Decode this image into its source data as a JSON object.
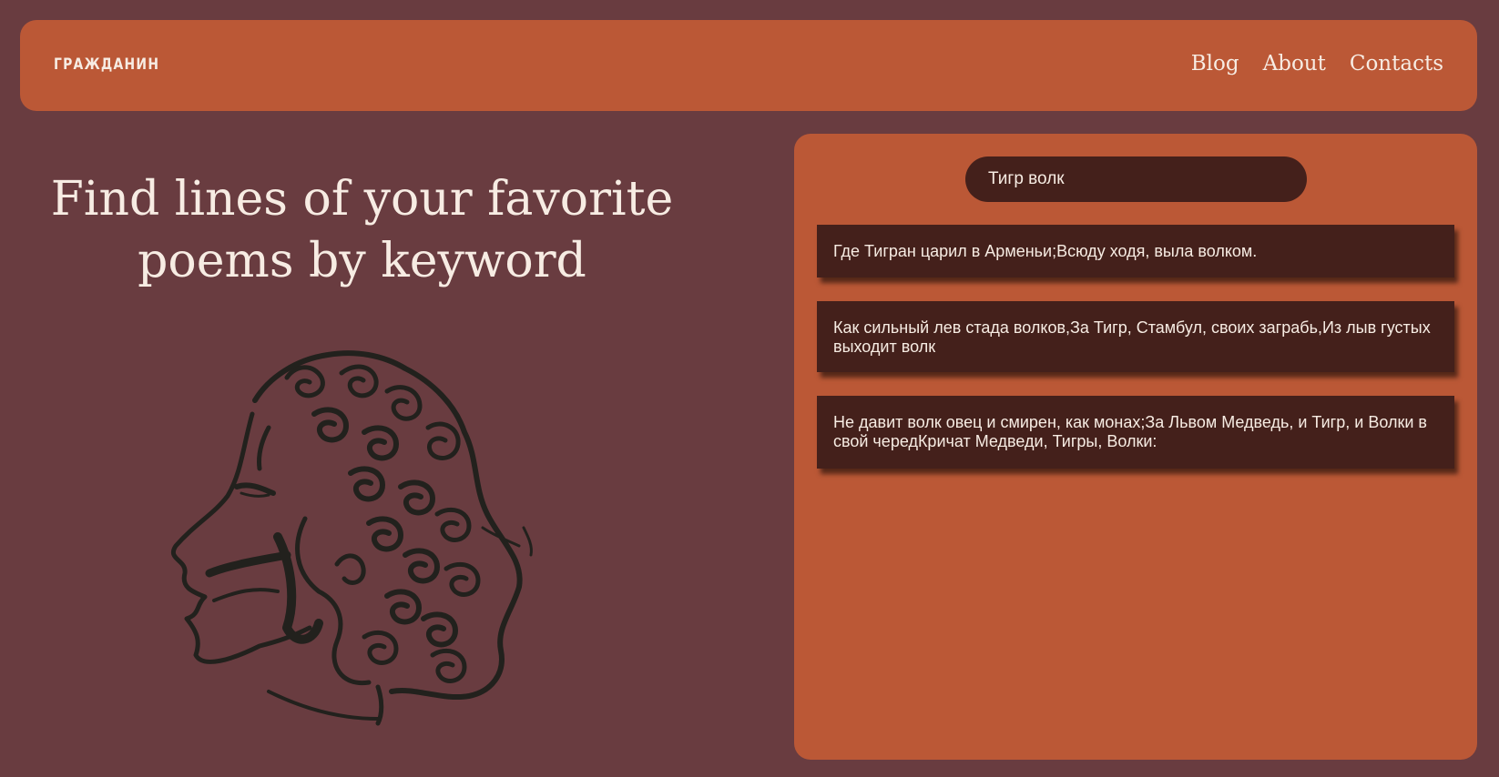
{
  "header": {
    "logo": "ГРАЖДАНИН",
    "nav": [
      {
        "label": "Blog"
      },
      {
        "label": "About"
      },
      {
        "label": "Contacts"
      }
    ]
  },
  "hero": {
    "line1": "Find lines of your favorite",
    "line2": "poems by keyword"
  },
  "search": {
    "value": "Тигр волк"
  },
  "results": [
    {
      "text": "Где Тигран царил в Арменьи;Всюду ходя, выла волком."
    },
    {
      "text": "Как сильный лев стада волков,За Тигр, Стамбул, своих заграбь,Из лыв густых выходит волк"
    },
    {
      "text": "Не давит волк овец и смирен, как монах;За Львом Медведь, и Тигр, и Волки в свой чередКричат Медведи, Тигры, Волки:"
    }
  ],
  "colors": {
    "background": "#693c40",
    "accent": "#bb5836",
    "dark": "#44201b",
    "text": "#f7ece3"
  },
  "icons": {
    "portrait": "pushkin-portrait-sketch"
  }
}
